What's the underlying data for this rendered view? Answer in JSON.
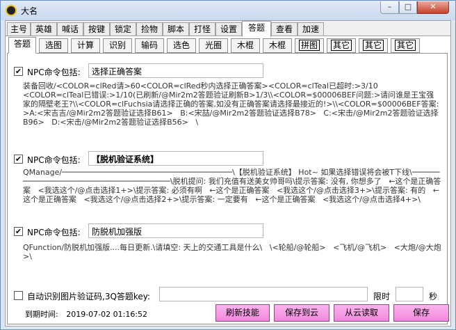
{
  "window": {
    "title": "大名",
    "min": "–",
    "max": "□",
    "close": "✕"
  },
  "tabs_main": [
    "主号",
    "英雄",
    "喊话",
    "按键",
    "锁定",
    "捡物",
    "脚本",
    "打怪",
    "设置",
    "答题",
    "查看",
    "加速"
  ],
  "tabs_sub": [
    "答题",
    "选图",
    "计算",
    "识别",
    "输码",
    "选色",
    "光圈",
    "木棍",
    "木棍",
    "拼图",
    "其它",
    "其它",
    "其它"
  ],
  "section1": {
    "checked": "✔",
    "label": "NPC命令包括:",
    "value": "选择正确答案",
    "text": "装备回收/<COLOR=clRed请>60<COLOR=clRed秒内选择正确答案><COLOR=clTeal已超时:>3/10\n<COLOR=clTeal已错误:>1/10(已刷新/@Mir2m2答题验证刷新B>1/3\\\\<COLOR=$00006BEF问题:>请问谁是王宝强家的隔壁老王?\\\\<COLOR=clFuchsia请选择正确的答案,如没有正确答案请选择最接近的!>\\\\<COLOR=$00006BEF答案:>A:<宋吉吉/@Mir2m2答题验证选择B61>   B:<宋喆/@Mir2m2答题验证选择B78>   C:<宋击/@Mir2m2答题验证选择B96>   D:<宋击/@Mir2m2答题验证选择B56>   \\"
  },
  "section2": {
    "checked": "✔",
    "label": "NPC命令包括:",
    "value": "【脱机验证系统】",
    "text": "QManage/─────────────────────────────────────\\【脱机验证系统】 Hot~ 如果选择错误将会被T下线\\──────────────────────────────────────\\脱机提问: 我们充值有送美女帅哥吗\\提示答案: 没有, 你想多了   ←这个是正确答案   <我选这个/@点击选择1+>\\提示答案: 必须有啊   ←这个是正确答案   <我选这个/@点击选择3+>\\提示答案: 有的   ←这个是正确答案   <我选这个/@点击选择2+>\\提示答案: 一定要有   ←这个是正确答案   <我选这个/@点击选择4+>\\"
  },
  "section3": {
    "checked": "✔",
    "label": "NPC命令包括:",
    "value": "防脱机加强版",
    "text": "QFunction/防脱机加强版....每日更新.\\请填空: 天上的交通工具是什么\\   \\<轮船/@轮船>   <飞机/@飞机>   <大炮/@大炮>\\"
  },
  "auto_verify": {
    "label": "自动识别图片验证码,3Q答题key:",
    "key_value": "",
    "limit_label": "限时",
    "limit_value": "",
    "seconds_label": "秒"
  },
  "status": {
    "expire_label": "到期时间:",
    "expire_value": "2019-07-02 01:16:52"
  },
  "buttons": {
    "refresh": "刷新技能",
    "save_cloud": "保存到云",
    "load_cloud": "从云读取",
    "save": "保存"
  }
}
